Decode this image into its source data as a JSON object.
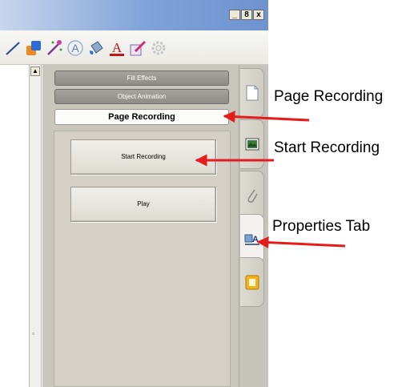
{
  "window": {
    "controls": [
      "_",
      "8",
      "x"
    ]
  },
  "toolbar": {
    "tools": [
      {
        "icon": "line-tool-icon"
      },
      {
        "icon": "shape-fill-icon"
      },
      {
        "icon": "magic-wand-icon"
      },
      {
        "icon": "text-effects-icon"
      },
      {
        "icon": "fill-bucket-icon"
      },
      {
        "icon": "text-color-icon",
        "glyph": "A"
      },
      {
        "icon": "pen-edit-icon"
      },
      {
        "icon": "gear-settings-icon"
      }
    ]
  },
  "panel": {
    "tabs": {
      "fill_effects": "Fill Effects",
      "object_animation": "Object Animation",
      "page_recording": "Page Recording"
    },
    "buttons": {
      "start_recording": "Start Recording",
      "play": "Play"
    }
  },
  "side_tabs": [
    {
      "icon": "page-sorter-icon"
    },
    {
      "icon": "gallery-icon"
    },
    {
      "icon": "attachments-icon"
    },
    {
      "icon": "properties-icon",
      "glyph": "A"
    },
    {
      "icon": "addons-icon"
    }
  ],
  "annotations": {
    "page_recording": "Page Recording",
    "start_recording": "Start Recording",
    "properties_tab": "Properties Tab"
  },
  "colors": {
    "arrow": "#e41c1c",
    "panel_bg": "#c9c6bd",
    "title_gradient_end": "#6e93cf"
  }
}
